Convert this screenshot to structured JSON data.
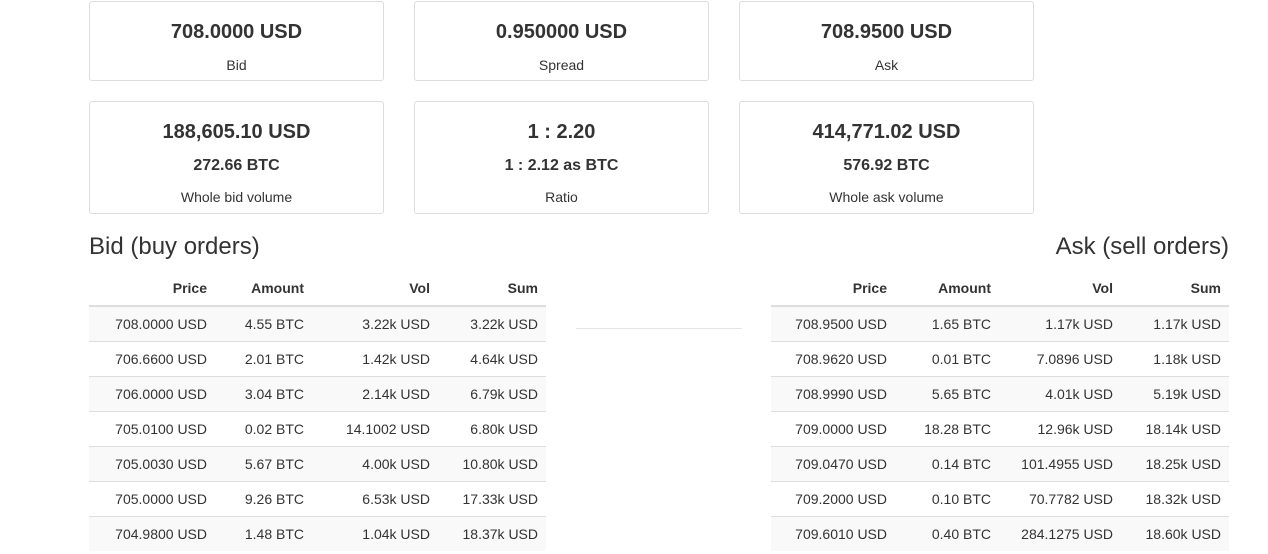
{
  "stats": {
    "bid": {
      "value": "708.0000 USD",
      "label": "Bid"
    },
    "spread": {
      "value": "0.950000 USD",
      "label": "Spread"
    },
    "ask": {
      "value": "708.9500 USD",
      "label": "Ask"
    },
    "bid_volume": {
      "value": "188,605.10 USD",
      "sub": "272.66 BTC",
      "label": "Whole bid volume"
    },
    "ratio": {
      "value": "1 : 2.20",
      "sub": "1 : 2.12 as BTC",
      "label": "Ratio"
    },
    "ask_volume": {
      "value": "414,771.02 USD",
      "sub": "576.92 BTC",
      "label": "Whole ask volume"
    }
  },
  "bid_section": {
    "title": "Bid (buy orders)",
    "columns": [
      "Price",
      "Amount",
      "Vol",
      "Sum"
    ],
    "rows": [
      [
        "708.0000 USD",
        "4.55 BTC",
        "3.22k USD",
        "3.22k USD"
      ],
      [
        "706.6600 USD",
        "2.01 BTC",
        "1.42k USD",
        "4.64k USD"
      ],
      [
        "706.0000 USD",
        "3.04 BTC",
        "2.14k USD",
        "6.79k USD"
      ],
      [
        "705.0100 USD",
        "0.02 BTC",
        "14.1002 USD",
        "6.80k USD"
      ],
      [
        "705.0030 USD",
        "5.67 BTC",
        "4.00k USD",
        "10.80k USD"
      ],
      [
        "705.0000 USD",
        "9.26 BTC",
        "6.53k USD",
        "17.33k USD"
      ],
      [
        "704.9800 USD",
        "1.48 BTC",
        "1.04k USD",
        "18.37k USD"
      ]
    ]
  },
  "ask_section": {
    "title": "Ask (sell orders)",
    "columns": [
      "Price",
      "Amount",
      "Vol",
      "Sum"
    ],
    "rows": [
      [
        "708.9500 USD",
        "1.65 BTC",
        "1.17k USD",
        "1.17k USD"
      ],
      [
        "708.9620 USD",
        "0.01 BTC",
        "7.0896 USD",
        "1.18k USD"
      ],
      [
        "708.9990 USD",
        "5.65 BTC",
        "4.01k USD",
        "5.19k USD"
      ],
      [
        "709.0000 USD",
        "18.28 BTC",
        "12.96k USD",
        "18.14k USD"
      ],
      [
        "709.0470 USD",
        "0.14 BTC",
        "101.4955 USD",
        "18.25k USD"
      ],
      [
        "709.2000 USD",
        "0.10 BTC",
        "70.7782 USD",
        "18.32k USD"
      ],
      [
        "709.6010 USD",
        "0.40 BTC",
        "284.1275 USD",
        "18.60k USD"
      ]
    ]
  }
}
